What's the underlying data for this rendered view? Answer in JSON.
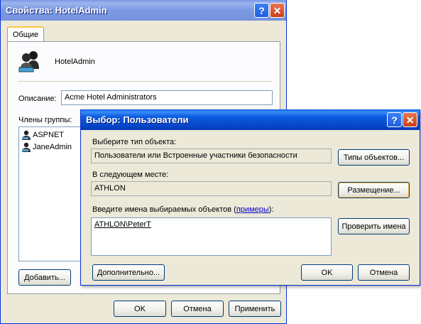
{
  "back_dialog": {
    "title": "Свойства: HotelAdmin",
    "tab_label": "Общие",
    "group_name": "HotelAdmin",
    "description_label": "Описание:",
    "description_value": "Acme Hotel Administrators",
    "members_label": "Члены группы:",
    "members": [
      "ASPNET",
      "JaneAdmin"
    ],
    "add_button": "Добавить...",
    "ok_button": "OK",
    "cancel_button": "Отмена",
    "apply_button": "Применить"
  },
  "front_dialog": {
    "title": "Выбор: Пользователи",
    "object_type_label": "Выберите тип объекта:",
    "object_type_value": "Пользователи или Встроенные участники безопасности",
    "object_types_button": "Типы объектов...",
    "location_label": "В следующем месте:",
    "location_value": "ATHLON",
    "location_button": "Размещение...",
    "names_label": "Введите имена выбираемых объектов (",
    "names_link": "примеры",
    "names_label_end": "):",
    "names_value": "ATHLON\\PeterT",
    "check_names_button": "Проверить имена",
    "advanced_button": "Дополнительно...",
    "ok_button": "OK",
    "cancel_button": "Отмена"
  },
  "icons": {
    "title_help": "?",
    "title_close": "✕"
  }
}
